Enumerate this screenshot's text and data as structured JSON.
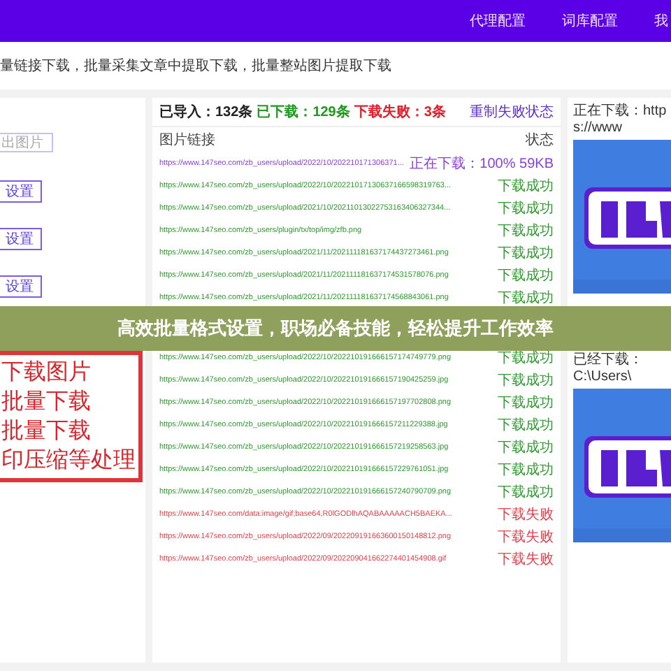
{
  "nav": {
    "items": [
      "代理配置",
      "词库配置",
      "我"
    ]
  },
  "subtitle": "量链接下载，批量采集文章中提取下载，批量整站图片提取下载",
  "left_panel": {
    "top_field": {
      "value": "出图片"
    },
    "settings": [
      {
        "button": "设置"
      },
      {
        "button": "设置"
      },
      {
        "button": "设置"
      }
    ],
    "promo_lines": [
      "下载图片",
      "批量下载",
      "批量下载",
      "印压缩等处理"
    ]
  },
  "table": {
    "stats": [
      {
        "kind": "imported",
        "text": "已导入：132条"
      },
      {
        "kind": "success",
        "text": "已下载：129条"
      },
      {
        "kind": "failed",
        "text": "下载失败：3条"
      }
    ],
    "reset_link": "重制失败状态",
    "columns": [
      "图片链接",
      "状态"
    ],
    "rows_top": [
      {
        "url": "https://www.147seo.com/zb_users/upload/2022/10/202210171306371...",
        "status": "正在下载：100% 59KB",
        "kind": "downloading"
      },
      {
        "url": "https://www.147seo.com/zb_users/upload/2022/10/20221017130637166598319763...",
        "status": "下载成功",
        "kind": "success"
      },
      {
        "url": "https://www.147seo.com/zb_users/upload/2021/10/20211013022753163406327344...",
        "status": "下载成功",
        "kind": "success"
      },
      {
        "url": "https://www.147seo.com/zb_users/plugin/tx/top/img/zfb.png",
        "status": "下载成功",
        "kind": "success"
      },
      {
        "url": "https://www.147seo.com/zb_users/upload/2021/11/202111181637174437273461.png",
        "status": "下载成功",
        "kind": "success"
      },
      {
        "url": "https://www.147seo.com/zb_users/upload/2021/11/202111181637174531578076.png",
        "status": "下载成功",
        "kind": "success"
      },
      {
        "url": "https://www.147seo.com/zb_users/upload/2021/11/202111181637174568843061.png",
        "status": "下载成功",
        "kind": "success"
      }
    ],
    "rows_bottom": [
      {
        "url": "https://www.147seo.com/zb_users/upload/2022/10/202210191666157174749779.png",
        "status": "下载成功",
        "kind": "success"
      },
      {
        "url": "https://www.147seo.com/zb_users/upload/2022/10/202210191666157190425259.jpg",
        "status": "下载成功",
        "kind": "success"
      },
      {
        "url": "https://www.147seo.com/zb_users/upload/2022/10/202210191666157197702808.png",
        "status": "下载成功",
        "kind": "success"
      },
      {
        "url": "https://www.147seo.com/zb_users/upload/2022/10/202210191666157211229388.jpg",
        "status": "下载成功",
        "kind": "success"
      },
      {
        "url": "https://www.147seo.com/zb_users/upload/2022/10/202210191666157219258563.jpg",
        "status": "下载成功",
        "kind": "success"
      },
      {
        "url": "https://www.147seo.com/zb_users/upload/2022/10/202210191666157229761051.jpg",
        "status": "下载成功",
        "kind": "success"
      },
      {
        "url": "https://www.147seo.com/zb_users/upload/2022/10/202210191666157240790709.png",
        "status": "下载成功",
        "kind": "success"
      },
      {
        "url": "https://www.147seo.com/data:image/gif;base64,R0lGODlhAQABAAAAACH5BAEKA...",
        "status": "下载失败",
        "kind": "failed"
      },
      {
        "url": "https://www.147seo.com/zb_users/upload/2022/09/202209191663600150148812.png",
        "status": "下载失败",
        "kind": "failed"
      },
      {
        "url": "https://www.147seo.com/zb_users/upload/2022/09/202209041662274401454908.gif",
        "status": "下载失败",
        "kind": "failed"
      }
    ]
  },
  "preview": [
    {
      "label": "正在下载：https://www",
      "kind": "picture"
    },
    {
      "label": "已经下载：C:\\Users\\",
      "kind": "picture"
    }
  ],
  "banner": {
    "text": "高效批量格式设置，职场必备技能，轻松提升工作效率"
  }
}
